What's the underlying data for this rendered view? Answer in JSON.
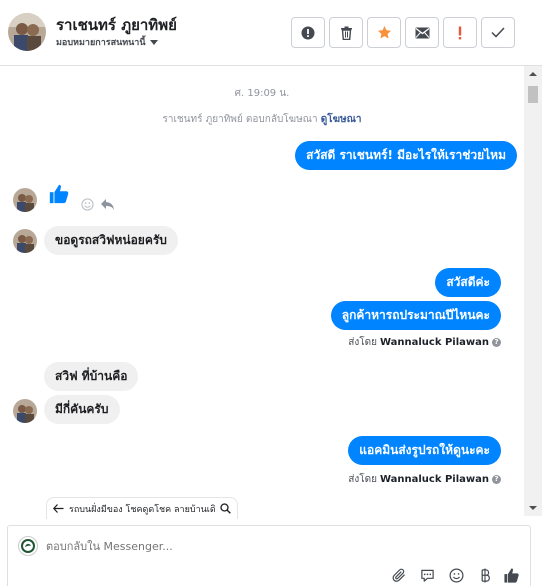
{
  "header": {
    "contact_name": "ราเชนทร์ ภูยาทิพย์",
    "assign_label": "มอบหมายการสนทนานี้"
  },
  "toolbar": {
    "buttons": [
      "report",
      "delete",
      "star",
      "mark-unread",
      "spam",
      "done"
    ],
    "accent_color": "#f7923a",
    "spam_color": "#e9573f"
  },
  "conversation": {
    "timestamp": "ศ. 19:09 น.",
    "reply_note_prefix": "ราเชนทร์ ภูยาทิพย์ ตอบกลับโฆษณา",
    "reply_note_link": "ดูโฆษณา",
    "messages": [
      {
        "side": "out",
        "text": "สวัสดี ราเชนทร์! มีอะไรให้เราช่วยไหม"
      },
      {
        "side": "in",
        "type": "like"
      },
      {
        "side": "in",
        "text": "ขอดูรถสวิฟหน่อยครับ"
      },
      {
        "side": "out",
        "text": "สวัสดีค่ะ"
      },
      {
        "side": "out",
        "text": "ลูกค้าหารถประมาณปีไหนคะ"
      },
      {
        "side": "in",
        "text": "สวิฟ ที่บ้านคือ"
      },
      {
        "side": "in",
        "text": "มีกี่คันครับ"
      },
      {
        "side": "out",
        "text": "แอคมินส่งรูปรถให้ดูนะคะ"
      }
    ],
    "sent_by_label": "ส่งโดย",
    "sent_by_name": "Wannaluck Pilawan",
    "sent_by_help": "?",
    "out_color": "#0084ff",
    "in_color": "#f1f0f0"
  },
  "saved_reply": {
    "text": "รถบนฝั่งมีของ โชคดูดโชค ลายบ้านเดิว"
  },
  "composer": {
    "placeholder": "ตอบกลับใน Messenger..."
  }
}
